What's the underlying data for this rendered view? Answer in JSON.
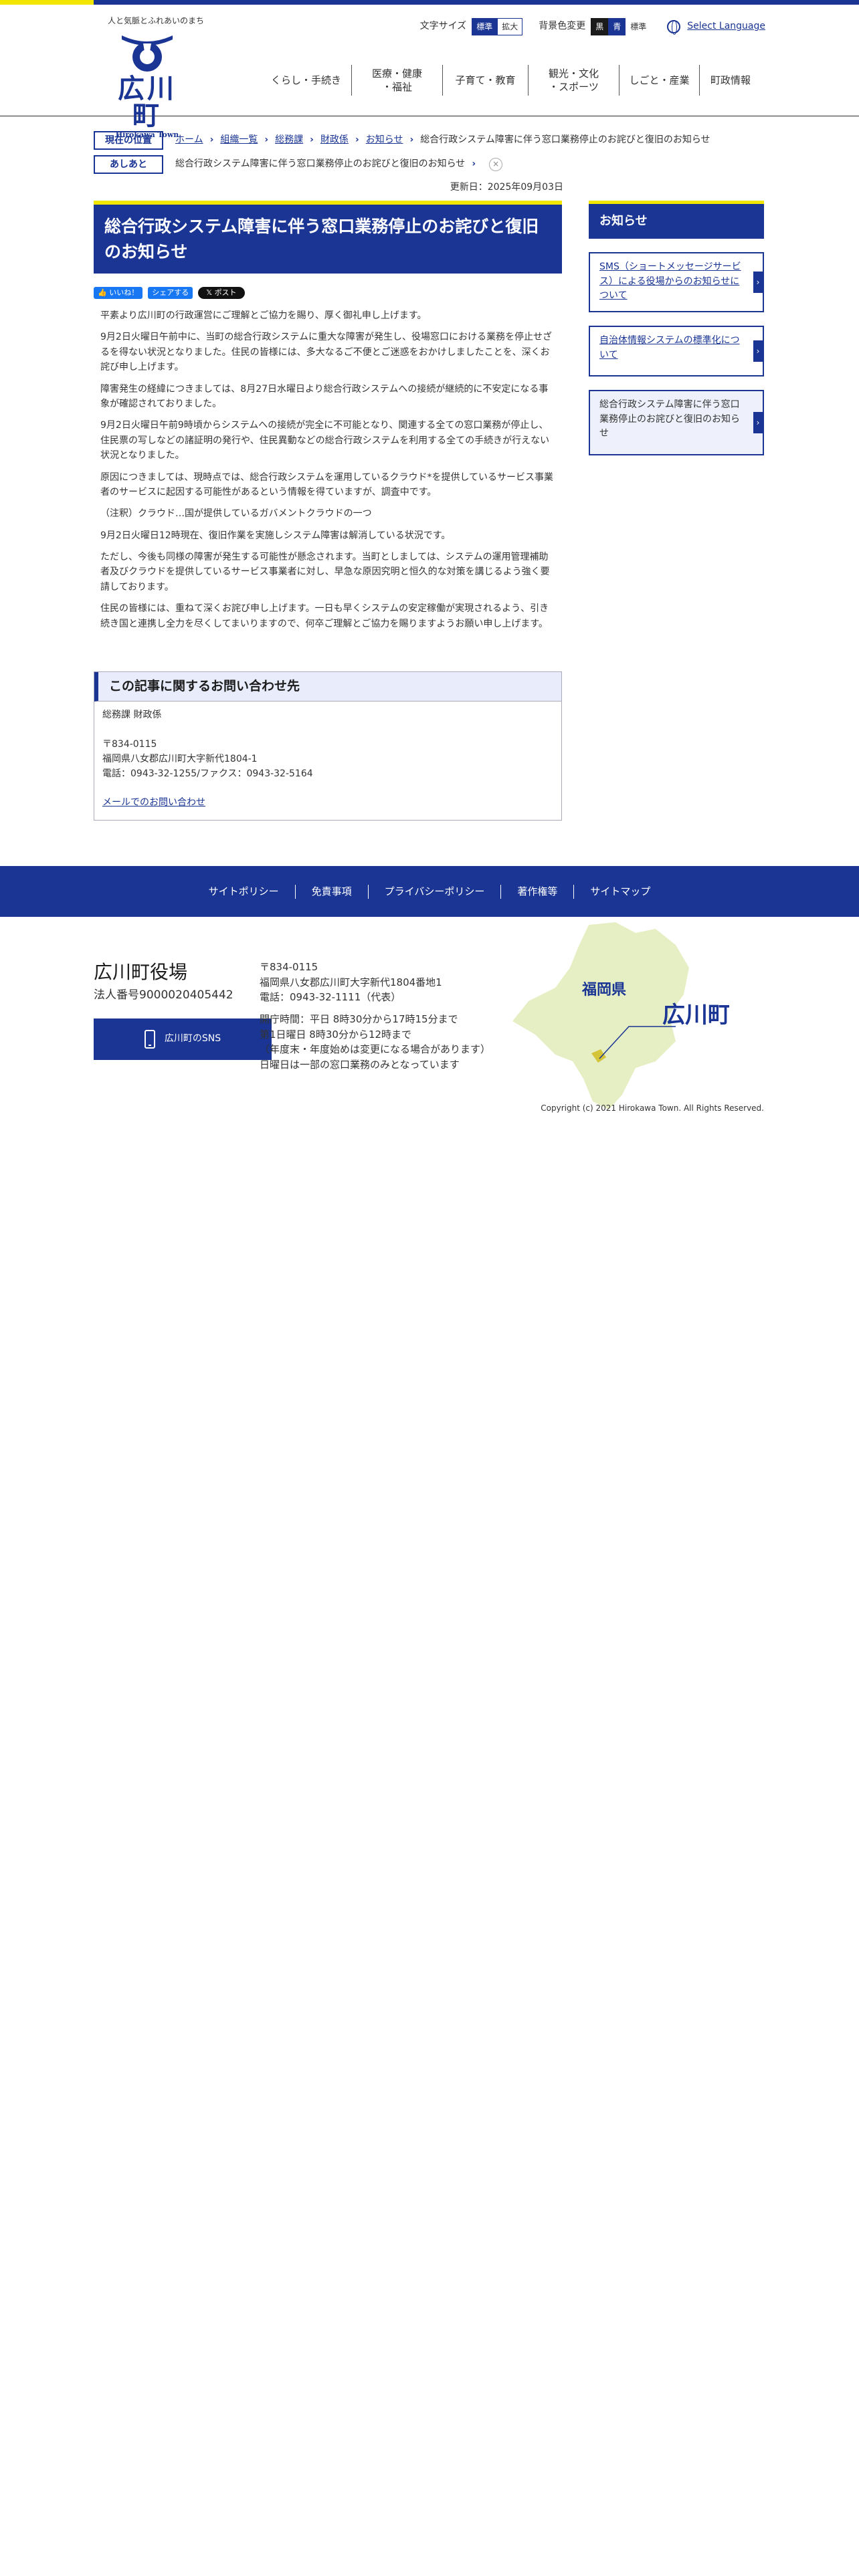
{
  "header": {
    "tagline": "人と気脈とふれあいのまち",
    "town_name": "広川町",
    "town_roman": "Hirokawa Town",
    "font_size_label": "文字サイズ",
    "font_size_standard": "標準",
    "font_size_large": "拡大",
    "bg_color_label": "背景色変更",
    "bg_black": "黒",
    "bg_blue": "青",
    "bg_standard": "標準",
    "language": "Select Language"
  },
  "gnav": [
    {
      "label": "くらし・手続き"
    },
    {
      "label": "医療・健康\n・福祉"
    },
    {
      "label": "子育て・教育"
    },
    {
      "label": "観光・文化\n・スポーツ"
    },
    {
      "label": "しごと・産業"
    },
    {
      "label": "町政情報"
    }
  ],
  "breadcrumb": {
    "label": "現在の位置",
    "items": [
      "ホーム",
      "組織一覧",
      "総務課",
      "財政係",
      "お知らせ"
    ],
    "current": "総合行政システム障害に伴う窓口業務停止のお詫びと復旧のお知らせ"
  },
  "history": {
    "label": "あしあと",
    "item": "総合行政システム障害に伴う窓口業務停止のお詫びと復旧のお知らせ",
    "close": "×"
  },
  "updated": "更新日：2025年09月03日",
  "article": {
    "title": "総合行政システム障害に伴う窓口業務停止のお詫びと復旧のお知らせ",
    "share_like": "いいね！",
    "share_share": "シェアする",
    "share_post": "ポスト",
    "paragraphs": [
      "平素より広川町の行政運営にご理解とご協力を賜り、厚く御礼申し上げます。",
      "9月2日火曜日午前中に、当町の総合行政システムに重大な障害が発生し、役場窓口における業務を停止せざるを得ない状況となりました。住民の皆様には、多大なるご不便とご迷惑をおかけしましたことを、深くお詫び申し上げます。",
      "障害発生の経緯につきましては、8月27日水曜日より総合行政システムへの接続が継続的に不安定になる事象が確認されておりました。",
      "9月2日火曜日午前9時頃からシステムへの接続が完全に不可能となり、関連する全ての窓口業務が停止し、住民票の写しなどの諸証明の発行や、住民異動などの総合行政システムを利用する全ての手続きが行えない状況となりました。",
      "原因につきましては、現時点では、総合行政システムを運用しているクラウド*を提供しているサービス事業者のサービスに起因する可能性があるという情報を得ていますが、調査中です。",
      "（注釈）クラウド…国が提供しているガバメントクラウドの一つ",
      "9月2日火曜日12時現在、復旧作業を実施しシステム障害は解消している状況です。",
      "ただし、今後も同様の障害が発生する可能性が懸念されます。当町としましては、システムの運用管理補助者及びクラウドを提供しているサービス事業者に対し、早急な原因究明と恒久的な対策を講じるよう強く要請しております。",
      "住民の皆様には、重ねて深くお詫び申し上げます。一日も早くシステムの安定稼働が実現されるよう、引き続き国と連携し全力を尽くしてまいりますので、何卒ご理解とご協力を賜りますようお願い申し上げます。"
    ]
  },
  "inquiry": {
    "heading": "この記事に関するお問い合わせ先",
    "dept": "総務課 財政係",
    "postal": "〒834-0115",
    "address": "福岡県八女郡広川町大字新代1804-1",
    "phone": "電話：0943-32-1255/ファクス：0943-32-5164",
    "mail_link": "メールでのお問い合わせ"
  },
  "sidebar": {
    "heading": "お知らせ",
    "items": [
      {
        "label": "SMS（ショートメッセージサービス）による役場からのお知らせについて"
      },
      {
        "label": "自治体情報システムの標準化について"
      },
      {
        "label": "総合行政システム障害に伴う窓口業務停止のお詫びと復旧のお知らせ"
      }
    ]
  },
  "footer_nav": [
    {
      "label": "サイトポリシー"
    },
    {
      "label": "免責事項"
    },
    {
      "label": "プライバシーポリシー"
    },
    {
      "label": "著作権等"
    },
    {
      "label": "サイトマップ"
    }
  ],
  "footer": {
    "office": "広川町役場",
    "corp_no": "法人番号9000020405442",
    "sns": "広川町のSNS",
    "postal": "〒834-0115",
    "address": "福岡県八女郡広川町大字新代1804番地1",
    "phone": "電話：0943-32-1111（代表）",
    "hours1": "開庁時間：平日 8時30分から17時15分まで",
    "hours2": "第1日曜日 8時30分から12時まで",
    "hours3": "（年度末・年度始めは変更になる場合があります）",
    "hours4": "日曜日は一部の窓口業務のみとなっています",
    "map_pref": "福岡県",
    "map_town": "広川町",
    "copyright": "Copyright (c) 2021 Hirokawa Town. All Rights Reserved."
  },
  "colors": {
    "brand": "#1a3594",
    "accent": "#f2e600",
    "map_fill": "#e6efc4"
  }
}
